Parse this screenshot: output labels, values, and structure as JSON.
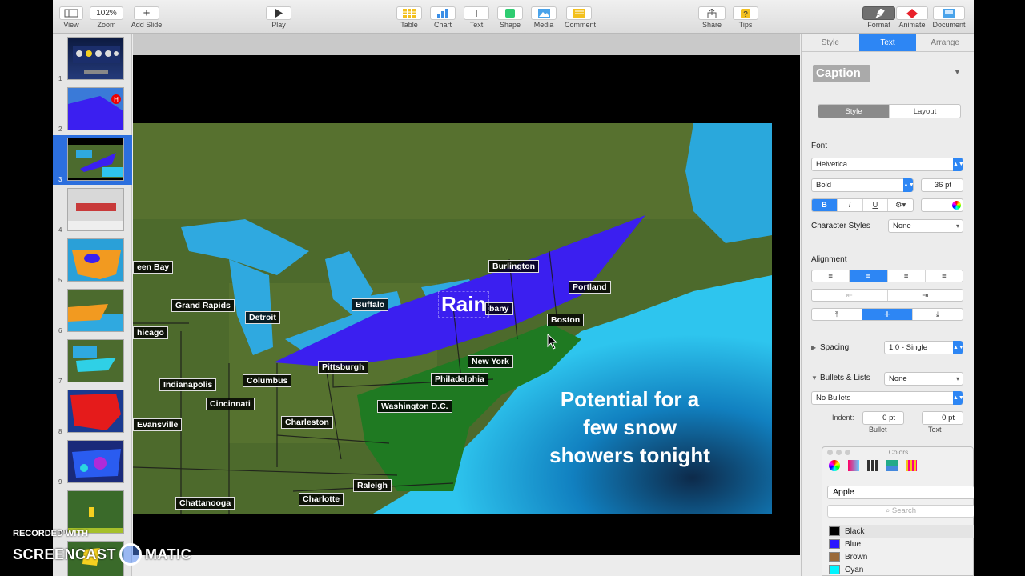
{
  "toolbar": {
    "view_label": "View",
    "zoom_value": "102%",
    "zoom_label": "Zoom",
    "add_slide_label": "Add Slide",
    "play_label": "Play",
    "table_label": "Table",
    "chart_label": "Chart",
    "text_label": "Text",
    "shape_label": "Shape",
    "media_label": "Media",
    "comment_label": "Comment",
    "share_label": "Share",
    "tips_label": "Tips",
    "format_label": "Format",
    "animate_label": "Animate",
    "document_label": "Document"
  },
  "navigator": {
    "slides": [
      {
        "number": "1"
      },
      {
        "number": "2"
      },
      {
        "number": "3",
        "selected": true
      },
      {
        "number": "4"
      },
      {
        "number": "5"
      },
      {
        "number": "6"
      },
      {
        "number": "7"
      },
      {
        "number": "8"
      },
      {
        "number": "9"
      },
      {
        "number": "10"
      },
      {
        "number": "11"
      }
    ]
  },
  "slide": {
    "rain_text": "Rain",
    "caption_line1": "Potential for a",
    "caption_line2": "few snow",
    "caption_line3": "showers tonight",
    "cities": {
      "green_bay": "een Bay",
      "grand_rapids": "Grand Rapids",
      "detroit": "Detroit",
      "chicago": "hicago",
      "buffalo": "Buffalo",
      "burlington": "Burlington",
      "portland": "Portland",
      "albany": "bany",
      "boston": "Boston",
      "pittsburgh": "Pittsburgh",
      "new_york": "New York",
      "philadelphia": "Philadelphia",
      "indianapolis": "Indianapolis",
      "columbus": "Columbus",
      "cincinnati": "Cincinnati",
      "evansville": "Evansville",
      "charleston": "Charleston",
      "washington": "Washington D.C.",
      "raleigh": "Raleigh",
      "chattanooga": "Chattanooga",
      "charlotte": "Charlotte"
    }
  },
  "inspector": {
    "tabs": [
      "Style",
      "Text",
      "Arrange"
    ],
    "paragraph_style": "Caption",
    "sub_tabs": [
      "Style",
      "Layout"
    ],
    "font_section": "Font",
    "font_family": "Helvetica",
    "font_weight": "Bold",
    "font_size": "36 pt",
    "bold_btn": "B",
    "italic_btn": "I",
    "underline_btn": "U",
    "character_styles_label": "Character Styles",
    "character_styles_value": "None",
    "alignment_label": "Alignment",
    "spacing_label": "Spacing",
    "spacing_value": "1.0 - Single",
    "bullets_label": "Bullets & Lists",
    "bullets_value": "None",
    "bullets_type": "No Bullets",
    "indent_label": "Indent:",
    "indent_bullet_value": "0 pt",
    "indent_text_value": "0 pt",
    "bullet_caption": "Bullet",
    "text_caption": "Text"
  },
  "colors_panel": {
    "title": "Colors",
    "palette": "Apple",
    "search_placeholder": "Search",
    "colors": [
      {
        "name": "Black",
        "hex": "#000000"
      },
      {
        "name": "Blue",
        "hex": "#2a16ff"
      },
      {
        "name": "Brown",
        "hex": "#9a6a3a"
      },
      {
        "name": "Cyan",
        "hex": "#00f5ff"
      }
    ]
  },
  "watermark": {
    "line1": "RECORDED WITH",
    "line2a": "SCREENCAST",
    "line2b": "MATIC"
  },
  "accent_color": "#2d86f4"
}
